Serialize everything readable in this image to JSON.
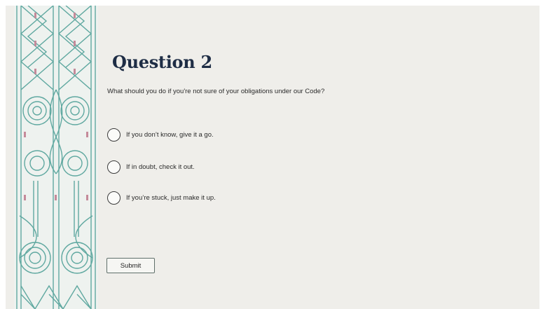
{
  "question": {
    "title": "Question 2",
    "prompt": "What should you do if you're not sure of your obligations under our Code?"
  },
  "options": [
    {
      "label": "If you don’t know, give it a go.",
      "selected": false
    },
    {
      "label": "If in doubt, check it out.",
      "selected": false
    },
    {
      "label": "If you’re stuck, just make it up.",
      "selected": false
    }
  ],
  "submit": {
    "label": "Submit"
  },
  "colors": {
    "title": "#1e2d45",
    "pattern_teal": "#5fa8a0",
    "pattern_accent": "#c58a9a",
    "background": "#efeeea"
  }
}
